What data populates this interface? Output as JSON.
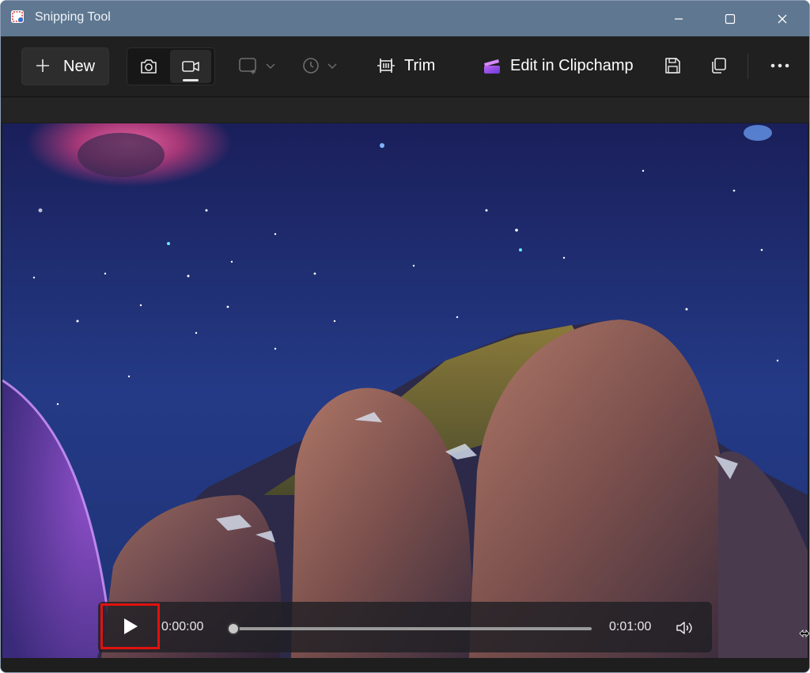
{
  "window": {
    "title": "Snipping Tool",
    "titlebar_color": "#5f7790"
  },
  "toolbar": {
    "new_label": "New",
    "trim_label": "Trim",
    "clipchamp_label": "Edit in Clipchamp",
    "icons": [
      "plus-icon",
      "camera-icon",
      "video-camera-icon",
      "rectangle-snip-icon",
      "timer-icon",
      "trim-icon",
      "clipchamp-icon",
      "save-icon",
      "copy-icon",
      "more-icon"
    ],
    "active_mode": "video"
  },
  "player": {
    "current_time": "0:00:00",
    "total_time": "0:01:00",
    "progress": 0,
    "highlight_color": "#e0120e"
  }
}
